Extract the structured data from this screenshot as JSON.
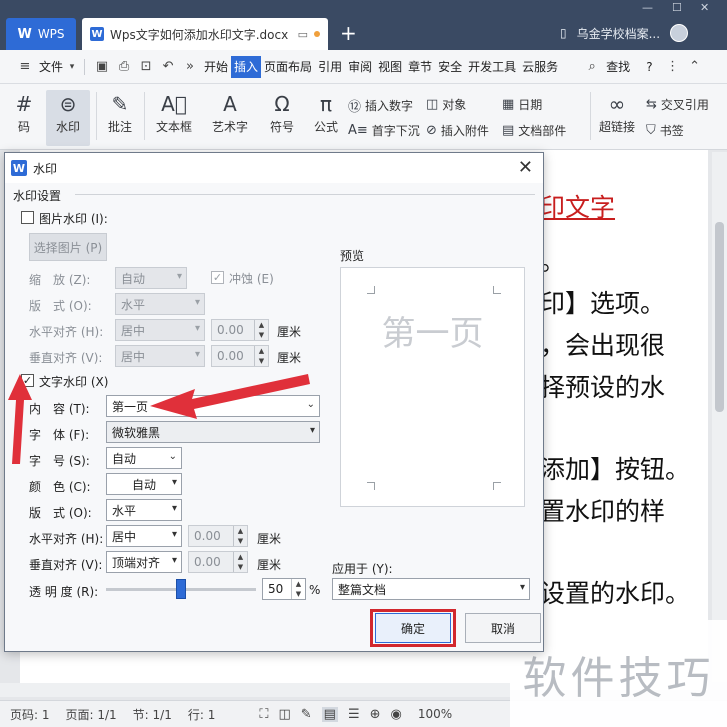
{
  "titlebar": {
    "wps_tab": "WPS",
    "doc_tab": "Wps文字如何添加水印文字.docx",
    "user": "乌金学校档案..."
  },
  "menubar": {
    "file": "文件",
    "tabs": [
      "开始",
      "插入",
      "页面布局",
      "引用",
      "审阅",
      "视图",
      "章节",
      "安全",
      "开发工具",
      "云服务"
    ],
    "active_tab": "插入",
    "search": "查找",
    "help": "?"
  },
  "ribbon": {
    "buttons": {
      "code": "码",
      "watermark": "水印",
      "comment": "批注",
      "textbox": "文本框",
      "wordart": "艺术字",
      "symbol": "符号",
      "formula": "公式",
      "insert_number": "插入数字",
      "object": "对象",
      "date": "日期",
      "dropcap": "首字下沉",
      "attachment": "插入附件",
      "docpart": "文档部件",
      "hyperlink": "超链接",
      "crossref": "交叉引用",
      "bookmark": "书签"
    }
  },
  "document": {
    "lines": [
      "印文字",
      "。",
      "印】选项。",
      "，会出现很",
      "择预设的水",
      "添加】按钮。",
      "置水印的样",
      "设置的水印。"
    ]
  },
  "dialog": {
    "title": "水印",
    "group_title": "水印设置",
    "picture_watermark": "图片水印 (I):",
    "select_picture": "选择图片 (P)",
    "scale_label": "缩　放 (Z):",
    "scale_value": "自动",
    "washout": "冲蚀 (E)",
    "layout_label": "版　式 (O):",
    "layout_value": "水平",
    "halign_label": "水平对齐 (H):",
    "halign_value": "居中",
    "halign_offset": "0.00",
    "valign_label": "垂直对齐 (V):",
    "valign_value": "居中",
    "valign_offset": "0.00",
    "unit": "厘米",
    "text_watermark": "文字水印 (X)",
    "content_label": "内　容 (T):",
    "content_value": "第一页",
    "font_label": "字　体 (F):",
    "font_value": "微软雅黑",
    "size_label": "字　号 (S):",
    "size_value": "自动",
    "color_label": "颜　色 (C):",
    "color_value": "自动",
    "tlayout_label": "版　式 (O):",
    "tlayout_value": "水平",
    "thalign_label": "水平对齐 (H):",
    "thalign_value": "居中",
    "thalign_offset": "0.00",
    "tvalign_label": "垂直对齐 (V):",
    "tvalign_value": "顶端对齐",
    "tvalign_offset": "0.00",
    "transparency_label": "透 明 度 (R):",
    "transparency_value": "50",
    "percent": "%",
    "preview_title": "预览",
    "preview_text": "第一页",
    "apply_label": "应用于 (Y):",
    "apply_value": "整篇文档",
    "ok": "确定",
    "cancel": "取消"
  },
  "statusbar": {
    "page_code": "页码: 1",
    "page": "页面: 1/1",
    "section": "节: 1/1",
    "row": "行: 1",
    "zoom": "100%"
  },
  "brand_watermark": "软件技巧",
  "colors": {
    "accent": "#2e6bd6",
    "titlebar": "#3a4a63",
    "highlight": "#d2282e",
    "arrow": "#e0303a"
  }
}
